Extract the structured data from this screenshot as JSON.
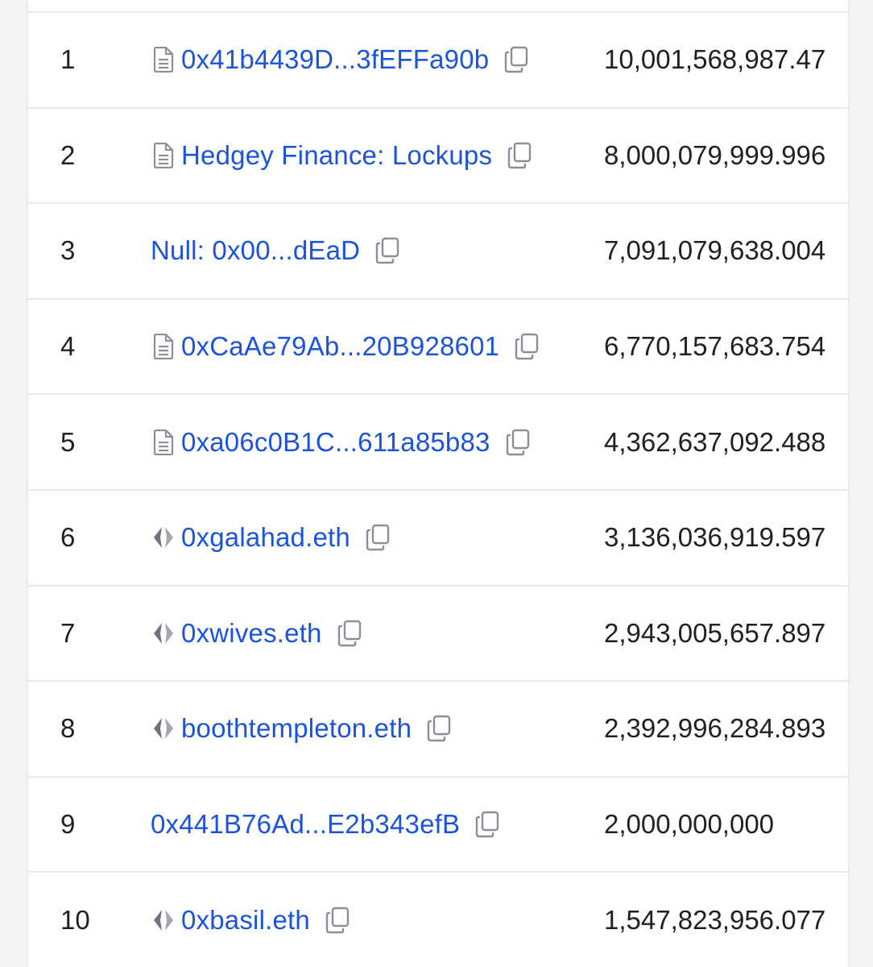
{
  "colors": {
    "link": "#1b54d8",
    "text": "#1e2025",
    "icon": "#8a8f98",
    "border": "#e7eaf0"
  },
  "holders": [
    {
      "rank": "1",
      "address": "0x41b4439D...3fEFFa90b",
      "icon": "contract-icon",
      "quantity": "10,001,568,987.47"
    },
    {
      "rank": "2",
      "address": "Hedgey Finance: Lockups",
      "icon": "contract-icon",
      "quantity": "8,000,079,999.996"
    },
    {
      "rank": "3",
      "address": "Null: 0x00...dEaD",
      "icon": "",
      "quantity": "7,091,079,638.004"
    },
    {
      "rank": "4",
      "address": "0xCaAe79Ab...20B928601",
      "icon": "contract-icon",
      "quantity": "6,770,157,683.754"
    },
    {
      "rank": "5",
      "address": "0xa06c0B1C...611a85b83",
      "icon": "contract-icon",
      "quantity": "4,362,637,092.488"
    },
    {
      "rank": "6",
      "address": "0xgalahad.eth",
      "icon": "ens-icon",
      "quantity": "3,136,036,919.597"
    },
    {
      "rank": "7",
      "address": "0xwives.eth",
      "icon": "ens-icon",
      "quantity": "2,943,005,657.897"
    },
    {
      "rank": "8",
      "address": "boothtempleton.eth",
      "icon": "ens-icon",
      "quantity": "2,392,996,284.893"
    },
    {
      "rank": "9",
      "address": "0x441B76Ad...E2b343efB",
      "icon": "",
      "quantity": "2,000,000,000"
    },
    {
      "rank": "10",
      "address": "0xbasil.eth",
      "icon": "ens-icon",
      "quantity": "1,547,823,956.077"
    }
  ]
}
